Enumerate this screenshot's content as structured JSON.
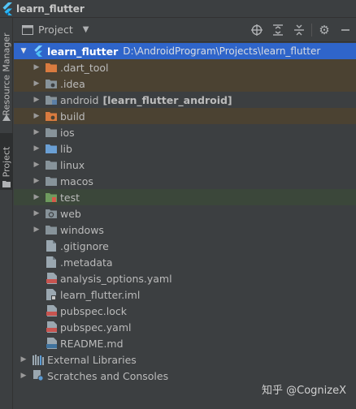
{
  "window": {
    "title": "learn_flutter"
  },
  "side_tabs": [
    {
      "label": "Resource Manager"
    },
    {
      "label": "Project"
    }
  ],
  "toolbar": {
    "view_selector": "Project"
  },
  "tree": {
    "root": {
      "label": "learn_flutter",
      "path": "D:\\AndroidProgram\\Projects\\learn_flutter"
    },
    "items": [
      {
        "label": ".dart_tool"
      },
      {
        "label": ".idea"
      },
      {
        "label": "android",
        "module": "[learn_flutter_android]"
      },
      {
        "label": "build"
      },
      {
        "label": "ios"
      },
      {
        "label": "lib"
      },
      {
        "label": "linux"
      },
      {
        "label": "macos"
      },
      {
        "label": "test"
      },
      {
        "label": "web"
      },
      {
        "label": "windows"
      },
      {
        "label": ".gitignore"
      },
      {
        "label": ".metadata"
      },
      {
        "label": "analysis_options.yaml"
      },
      {
        "label": "learn_flutter.iml"
      },
      {
        "label": "pubspec.lock"
      },
      {
        "label": "pubspec.yaml"
      },
      {
        "label": "README.md"
      }
    ],
    "external_libraries": "External Libraries",
    "scratches": "Scratches and Consoles"
  },
  "watermark": "知乎 @CognizeX",
  "colors": {
    "selection": "#2f65ca",
    "excluded_bg": "#4b4232",
    "test_bg": "#3b473a",
    "folder": "#87939a",
    "excluded_folder": "#d97b3f",
    "flutter": "#42a5f5"
  }
}
